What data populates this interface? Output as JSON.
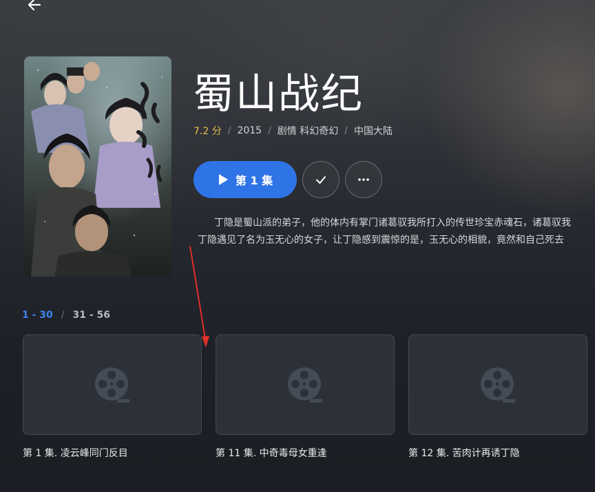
{
  "show": {
    "title": "蜀山战纪",
    "rating": "7.2 分",
    "year": "2015",
    "genres": "剧情 科幻奇幻",
    "region": "中国大陆",
    "description_line1": "丁隐是蜀山派的弟子，他的体内有掌门诸葛驭我所打入的传世珍宝赤魂石，诸葛驭我",
    "description_line2": "，丁隐遇见了名为玉无心的女子，让丁隐感到震惊的是，玉无心的相貌，竟然和自己死去"
  },
  "actions": {
    "play_label": "第 1 集"
  },
  "ranges": {
    "active": "1 - 30",
    "separator": "/",
    "other": "31 - 56"
  },
  "episodes": [
    {
      "title": "第 1 集. 凌云峰同门反目"
    },
    {
      "title": "第 11 集. 中奇毒母女重逢"
    },
    {
      "title": "第 12 集. 苦肉计再诱丁隐"
    }
  ],
  "icons": {
    "back": "arrow-left-icon",
    "play": "play-icon",
    "check": "check-icon",
    "more": "more-horizontal-icon",
    "episode_placeholder": "film-reel-icon"
  },
  "colors": {
    "accent": "#2f74e6",
    "rating": "#e4c04a",
    "range_active": "#3a84f0",
    "annotation_arrow": "#e0302a"
  }
}
